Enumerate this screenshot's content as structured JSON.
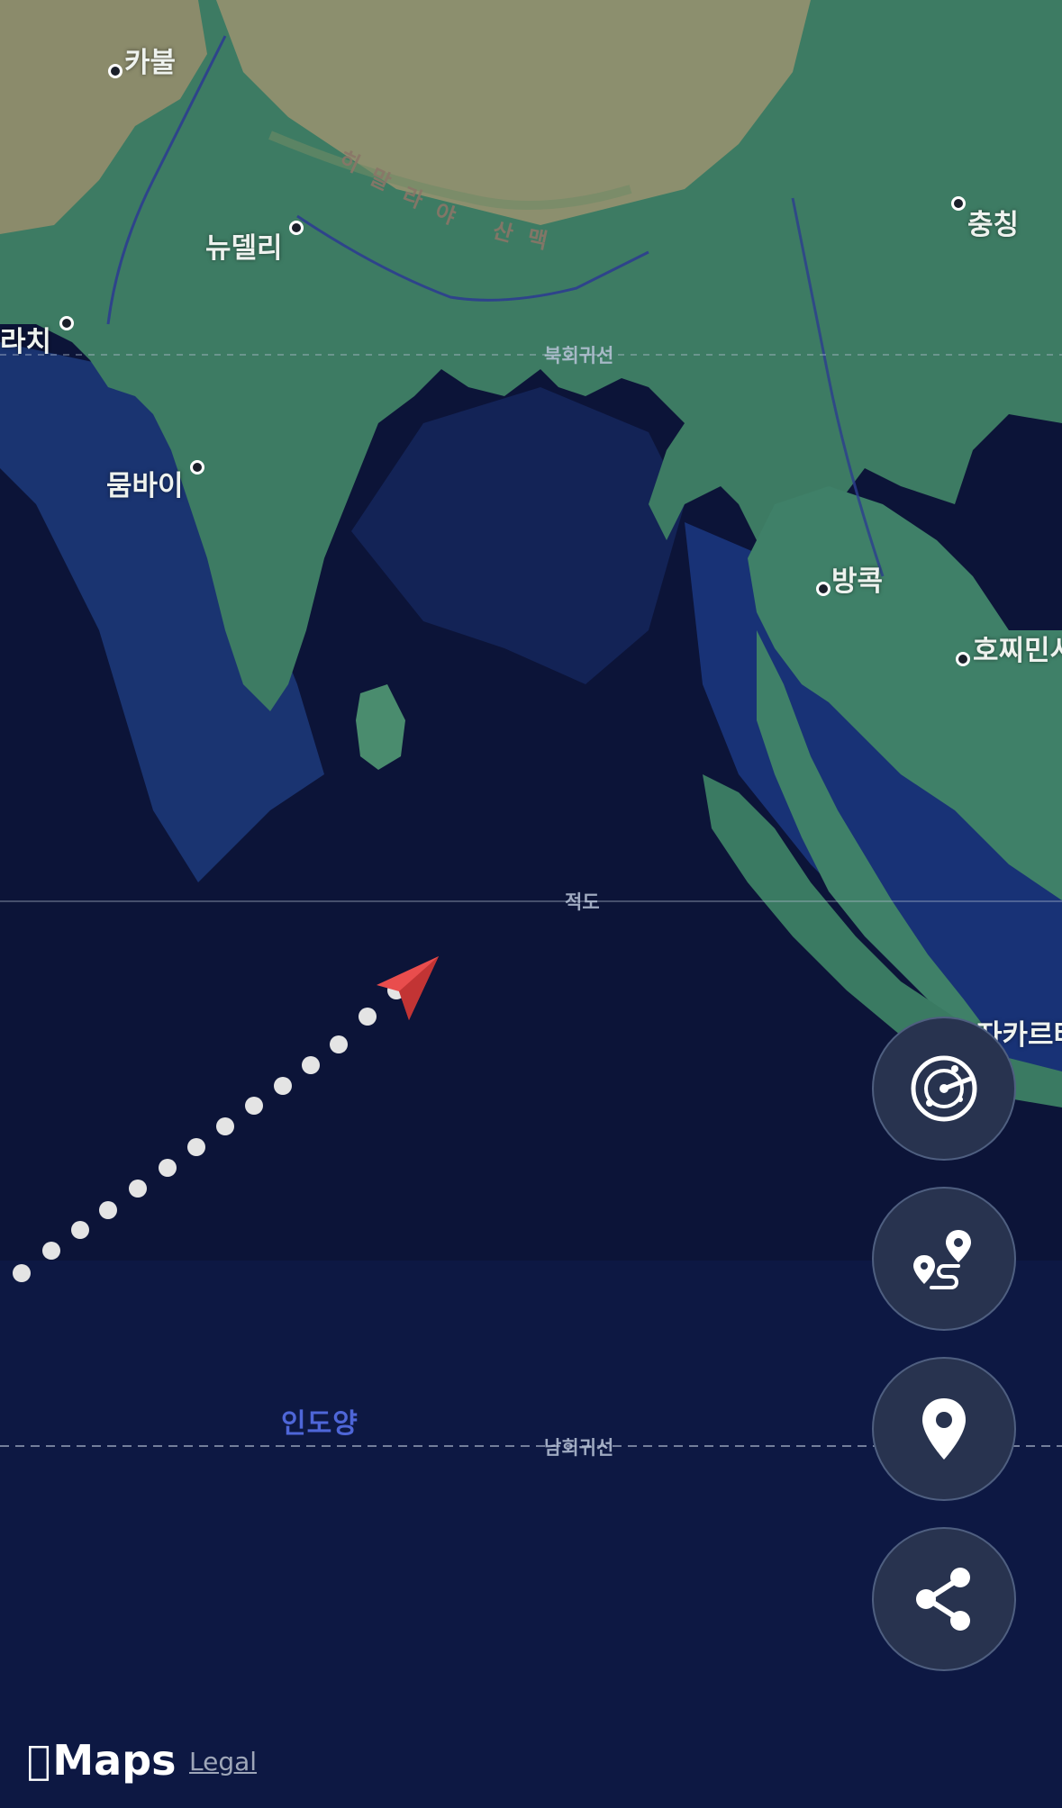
{
  "map": {
    "cities": [
      {
        "name": "카불"
      },
      {
        "name": "뉴델리"
      },
      {
        "name": "라치"
      },
      {
        "name": "뭄바이"
      },
      {
        "name": "충칭"
      },
      {
        "name": "방콕"
      },
      {
        "name": "호찌민시"
      },
      {
        "name": "자카르타"
      }
    ],
    "mountain_range": {
      "name": "히말라야 산맥",
      "chars": [
        "히",
        "말",
        "라",
        "야",
        "산",
        "맥"
      ]
    },
    "lines": {
      "tropic_cancer": "북회귀선",
      "equator": "적도",
      "tropic_capricorn": "남회귀선"
    },
    "ocean": "인도양",
    "colors": {
      "ocean": "#0b1235",
      "land": "#3f7f68",
      "highland": "#8f8a6a",
      "route_dots": "#e6e6e6",
      "plane_arrow": "#e94f4f"
    }
  },
  "controls": [
    {
      "id": "radar",
      "icon": "radar-icon"
    },
    {
      "id": "route",
      "icon": "route-icon"
    },
    {
      "id": "location",
      "icon": "location-pin-icon"
    },
    {
      "id": "share",
      "icon": "share-icon"
    }
  ],
  "footer": {
    "brand": "Maps",
    "legal": "Legal"
  }
}
